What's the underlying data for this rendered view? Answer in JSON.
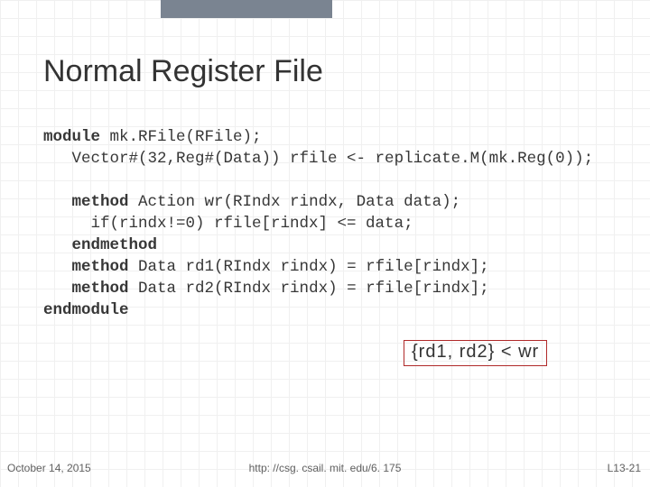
{
  "title": "Normal Register File",
  "code": {
    "l1_kw": "module",
    "l1_rest": " mk.RFile(RFile);",
    "l2": "   Vector#(32,Reg#(Data)) rfile <- replicate.M(mk.Reg(0));",
    "blank": "",
    "l3_indent": "   ",
    "l3_kw": "method",
    "l3_rest": " Action wr(RIndx rindx, Data data);",
    "l4": "     if(rindx!=0) rfile[rindx] <= data;",
    "l5_indent": "   ",
    "l5_kw": "endmethod",
    "l6_indent": "   ",
    "l6_kw": "method",
    "l6_rest": " Data rd1(RIndx rindx) = rfile[rindx];",
    "l7_indent": "   ",
    "l7_kw": "method",
    "l7_rest": " Data rd2(RIndx rindx) = rfile[rindx];",
    "l8_kw": "endmodule"
  },
  "annotation": "{rd1, rd2} < wr",
  "footer": {
    "left": "October 14, 2015",
    "center": "http: //csg. csail. mit. edu/6. 175",
    "right": "L13-21"
  }
}
